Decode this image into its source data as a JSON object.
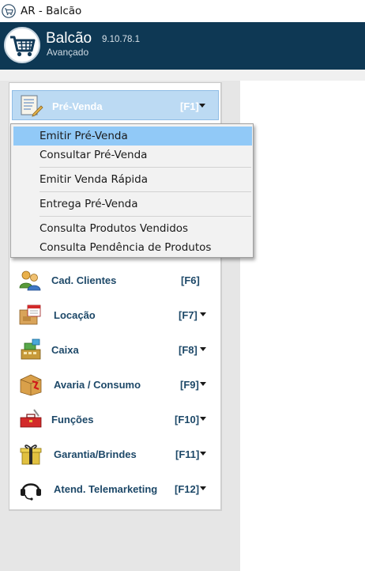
{
  "window": {
    "title": "AR - Balcão",
    "icon": "shopping-cart-icon"
  },
  "header": {
    "app_name": "Balcão",
    "version": "9.10.78.1",
    "mode": "Avançado",
    "logo_icon": "shopping-cart-icon"
  },
  "sidebar": {
    "items": [
      {
        "label": "Pré-Venda",
        "key": "[F1]",
        "icon": "pre-sale-form-icon",
        "has_submenu": true,
        "active": true
      },
      {
        "label": "Cad. Clientes",
        "key": "[F6]",
        "icon": "clients-icon",
        "has_submenu": false
      },
      {
        "label": "Locação",
        "key": "[F7]",
        "icon": "rental-calendar-icon",
        "has_submenu": true
      },
      {
        "label": "Caixa",
        "key": "[F8]",
        "icon": "cash-register-icon",
        "has_submenu": true
      },
      {
        "label": "Avaria / Consumo",
        "key": "[F9]",
        "icon": "damage-box-icon",
        "has_submenu": true
      },
      {
        "label": "Funções",
        "key": "[F10]",
        "icon": "toolbox-icon",
        "has_submenu": true
      },
      {
        "label": "Garantia/Brindes",
        "key": "[F11]",
        "icon": "gift-box-icon",
        "has_submenu": true
      },
      {
        "label": "Atend. Telemarketing",
        "key": "[F12]",
        "icon": "headset-icon",
        "has_submenu": true
      }
    ]
  },
  "dropdown": {
    "items": [
      {
        "label": "Emitir Pré-Venda",
        "highlighted": true
      },
      {
        "label": "Consultar Pré-Venda"
      },
      {
        "label": "Emitir Venda Rápida"
      },
      {
        "label": "Entrega Pré-Venda"
      },
      {
        "label": "Consulta Produtos Vendidos"
      },
      {
        "label": "Consulta Pendência de Produtos"
      }
    ]
  },
  "colors": {
    "header_bg": "#0e3854",
    "menu_label": "#1d4868",
    "active_item_bg": "#bcdaf3",
    "dropdown_highlight": "#91c9f7"
  }
}
